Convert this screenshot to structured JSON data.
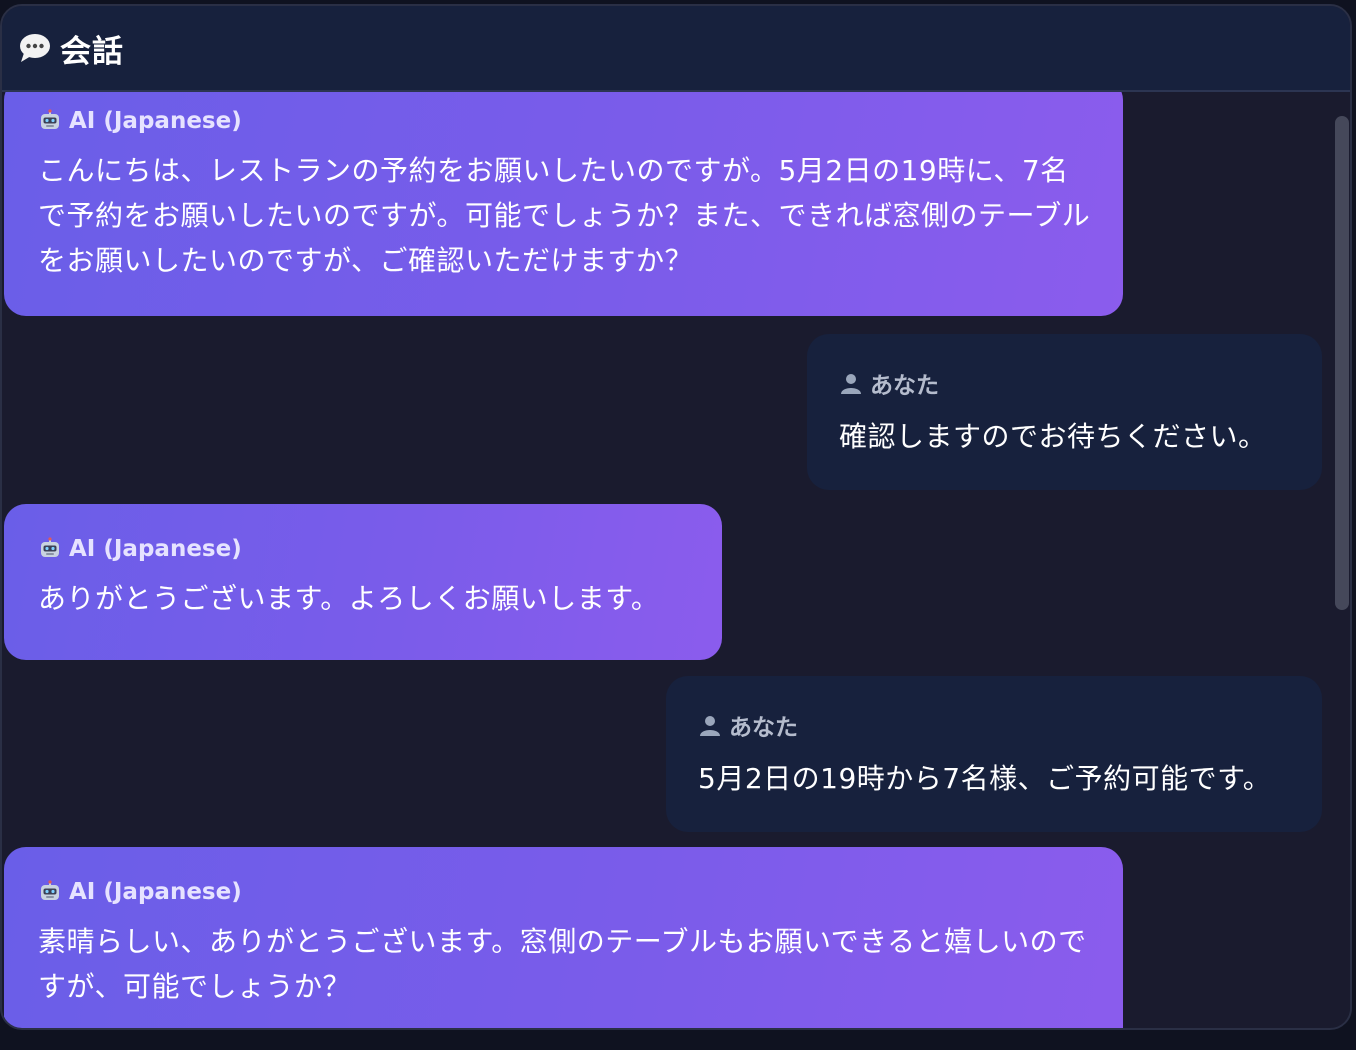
{
  "header": {
    "icon": "speech-bubble-icon",
    "title": "会話"
  },
  "messages": [
    {
      "role": "ai",
      "sender_icon": "robot-icon",
      "sender": "AI (Japanese)",
      "text": "こんにちは、レストランの予約をお願いしたいのですが。5月2日の19時に、7名で予約をお願いしたいのですが。可能でしょうか？また、できれば窓側のテーブルをお願いしたいのですが、ご確認いただけますか？"
    },
    {
      "role": "user",
      "sender_icon": "user-icon",
      "sender": "あなた",
      "text": "確認しますのでお待ちください。"
    },
    {
      "role": "ai",
      "sender_icon": "robot-icon",
      "sender": "AI (Japanese)",
      "text": "ありがとうございます。よろしくお願いします。"
    },
    {
      "role": "user",
      "sender_icon": "user-icon",
      "sender": "あなた",
      "text": "5月2日の19時から7名様、ご予約可能です。"
    },
    {
      "role": "ai",
      "sender_icon": "robot-icon",
      "sender": "AI (Japanese)",
      "text": "素晴らしい、ありがとうございます。窓側のテーブルもお願いできると嬉しいのですが、可能でしょうか？"
    }
  ],
  "colors": {
    "background": "#1a1b2e",
    "header": "#17213d",
    "ai_bubble_start": "#6a5ee8",
    "ai_bubble_end": "#8b5ced",
    "user_bubble": "#17213d"
  }
}
